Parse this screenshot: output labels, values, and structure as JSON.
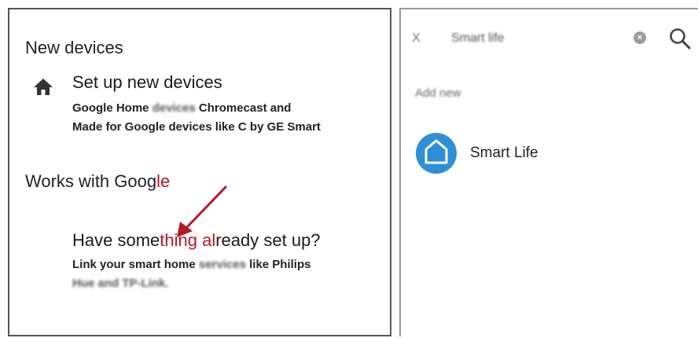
{
  "left": {
    "new_devices_heading": "New devices",
    "setup": {
      "title": "Set up new devices",
      "desc_line1_a": "Google Home ",
      "desc_line1_blur": "devices",
      "desc_line1_b": " Chromecast and",
      "desc_line2": "Made for Google devices like C by GE Smart"
    },
    "works_heading_a": "Works with Goog",
    "works_heading_b": "le",
    "have": {
      "title_a": "Have some",
      "title_red": "thing al",
      "title_b": "ready set up?",
      "desc_line1_a": "Link your smart home ",
      "desc_line1_blur": "services",
      "desc_line1_b": " like Philips",
      "desc_line2_blur": "Hue and TP-Link."
    }
  },
  "right": {
    "close_glyph": "X",
    "search_value": "Smart life",
    "clear_glyph": "×",
    "section_label": "Add new",
    "result_label": "Smart Life"
  },
  "colors": {
    "annotation_arrow": "#b0192a",
    "smart_life_blue": "#2f8fd6"
  },
  "icons": [
    "home-icon",
    "close-icon",
    "clear-icon",
    "search-icon",
    "smart-life-app-icon",
    "annotation-arrow"
  ]
}
